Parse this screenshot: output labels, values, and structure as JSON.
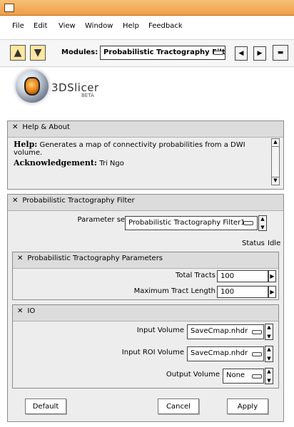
{
  "menu": {
    "items": [
      "File",
      "Edit",
      "View",
      "Window",
      "Help",
      "Feedback"
    ]
  },
  "toolbar": {
    "modules_label": "Modules:",
    "module_selected": "Probabilistic Tractography Filter"
  },
  "logo": {
    "name": "3DSlicer",
    "tag": "BETA"
  },
  "help_panel": {
    "title": "Help & About",
    "help_label": "Help:",
    "help_text": "Generates a map of connectivity probabilities from a DWI volume.",
    "ack_label": "Acknowledgement:",
    "ack_text": "Tri Ngo"
  },
  "filter_panel": {
    "title": "Probabilistic Tractography Filter",
    "parameter_set_label": "Parameter set",
    "parameter_set_value": "Probabilistic Tractography Filter1",
    "status_label": "Status",
    "status_value": "Idle"
  },
  "params_panel": {
    "title": "Probabilistic Tractography Parameters",
    "total_tracts_label": "Total Tracts",
    "total_tracts_value": "100",
    "max_length_label": "Maximum Tract Length",
    "max_length_value": "100"
  },
  "io_panel": {
    "title": "IO",
    "input_volume_label": "Input Volume",
    "input_volume_value": "SaveCmap.nhdr",
    "input_roi_label": "Input ROI Volume",
    "input_roi_value": "SaveCmap.nhdr",
    "output_volume_label": "Output Volume",
    "output_volume_value": "None"
  },
  "buttons": {
    "default": "Default",
    "cancel": "Cancel",
    "apply": "Apply"
  },
  "icons": {
    "close": "close-icon",
    "spin": "spin-arrows-icon",
    "dropdown": "dropdown-icon"
  },
  "colors": {
    "titlebar": "#ef9c46",
    "panel_bg": "#ededed",
    "panel_header": "#dcdcdc"
  }
}
